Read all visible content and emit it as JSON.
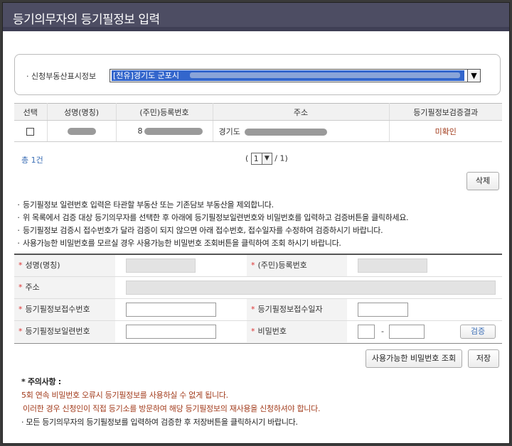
{
  "title": "등기의무자의 등기필정보 입력",
  "property_select": {
    "label": "신청부동산표시정보",
    "value": "[전유]경기도 군포시"
  },
  "table": {
    "headers": [
      "선택",
      "성명(명칭)",
      "(주민)등록번호",
      "주소",
      "등기필정보검증결과"
    ],
    "row": {
      "reg_no_prefix": "8",
      "address_prefix": "경기도",
      "result": "미확인"
    }
  },
  "pagination": {
    "total": "총 1건",
    "open": "(",
    "current": "1",
    "of": "/ 1)"
  },
  "buttons": {
    "delete": "삭제",
    "check_pw": "사용가능한 비밀번호 조회",
    "save": "저장",
    "verify": "검증"
  },
  "notes": [
    "등기필정보 일련번호 입력은 타관할 부동산 또는 기존담보 부동산을 제외합니다.",
    "위 목록에서 검증 대상 등기의무자를 선택한 후 아래에 등기필정보일련번호와 비밀번호를 입력하고 검증버튼을 클릭하세요.",
    "등기필정보 검증시 접수번호가 달라 검증이 되지 않으면 아래 접수번호, 접수일자를 수정하여 검증하시기 바랍니다.",
    "사용가능한 비밀번호를 모르실 경우 사용가능한 비밀번호 조회버튼을 클릭하여 조회 하시기 바랍니다."
  ],
  "form": {
    "required_mark": "*",
    "name_label": "성명(명칭)",
    "regno_label": "(주민)등록번호",
    "address_label": "주소",
    "receipt_no_label": "등기필정보접수번호",
    "receipt_date_label": "등기필정보접수일자",
    "serial_label": "등기필정보일련번호",
    "password_label": "비밀번호",
    "dash": "-"
  },
  "caution": {
    "head": "* 주의사항 :",
    "line1": "5회 연속 비밀번호 오류시 등기필정보를 사용하실 수 없게 됩니다.",
    "line2": "이러한 경우 신청인이 직접 등기소를 방문하여 해당 등기필정보의 재사용을 신청하셔야 합니다.",
    "line3": "· 모든 등기의무자의 등기필정보를 입력하여 검증한 후 저장버튼을 클릭하시기 바랍니다."
  },
  "colors": {
    "title_bg": "#4d4d63",
    "accent_blue": "#3a6db5",
    "required_red": "#d33333",
    "caution_red": "#a23b1b"
  }
}
